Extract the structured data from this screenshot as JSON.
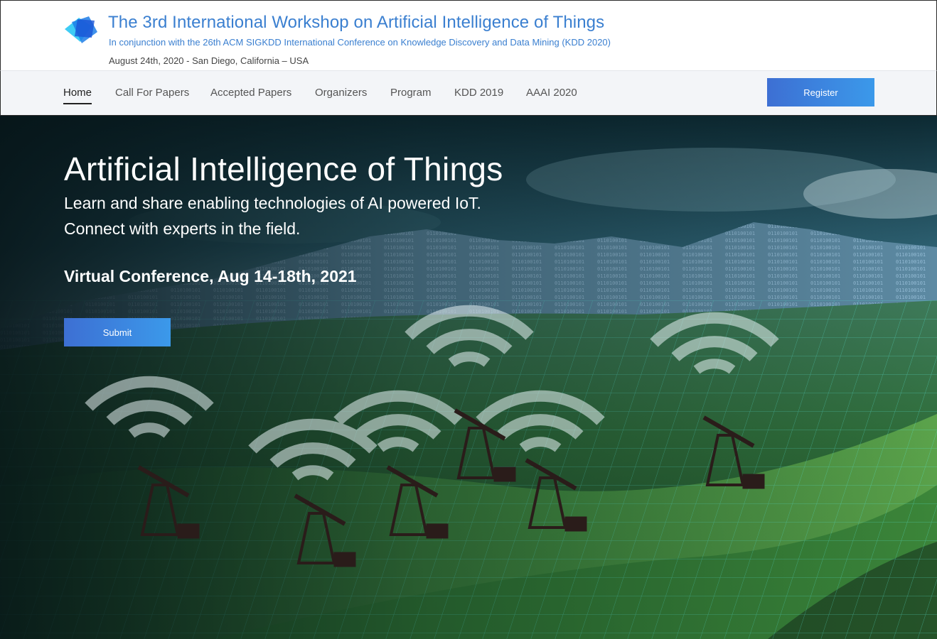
{
  "header": {
    "title": "The 3rd International Workshop on Artificial Intelligence of Things",
    "subtitle": "In conjunction with the 26th ACM SIGKDD International Conference on Knowledge Discovery and Data Mining (KDD 2020)",
    "date_location": "August 24th, 2020 - San Diego, California – USA",
    "logo_icon": "layered-squares-logo"
  },
  "nav": {
    "items": [
      {
        "label": "Home",
        "active": true
      },
      {
        "label": "Call For Papers",
        "active": false
      },
      {
        "label": "Accepted Papers",
        "active": false
      },
      {
        "label": "Organizers",
        "active": false
      },
      {
        "label": "Program",
        "active": false
      },
      {
        "label": "KDD 2019",
        "active": false
      },
      {
        "label": "AAAI 2020",
        "active": false
      }
    ],
    "register_label": "Register"
  },
  "hero": {
    "title": "Artificial Intelligence of Things",
    "line1": "Learn and share enabling technologies of AI powered IoT.",
    "line2": "Connect with experts in the field.",
    "event": "Virtual Conference, Aug 14-18th, 2021",
    "submit_label": "Submit",
    "background": "green-field-oil-pumps-wifi-signals-image"
  },
  "colors": {
    "brand_blue": "#3a7fd0",
    "button_gradient_start": "#3d6fd3",
    "button_gradient_end": "#3b99ea",
    "nav_bg": "#f3f5f8"
  }
}
